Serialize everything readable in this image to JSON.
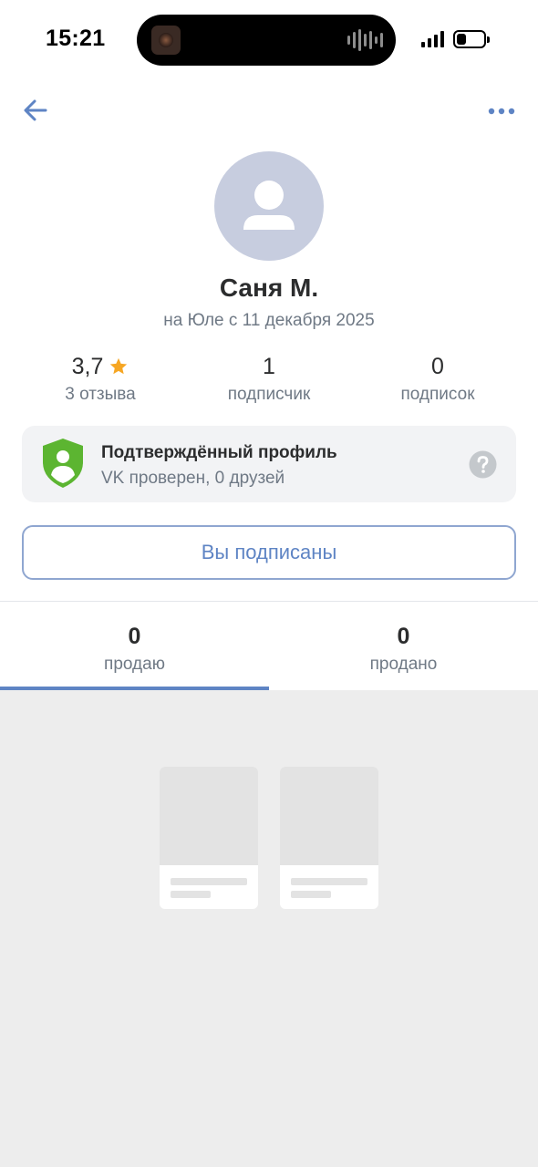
{
  "status_bar": {
    "time": "15:21",
    "battery_level": 0.35
  },
  "nav": {
    "back_icon": "arrow-left-icon",
    "more_icon": "more-horizontal-icon",
    "accent_color": "#5e84c4"
  },
  "profile": {
    "name": "Саня М.",
    "member_since": "на Юле с 11 декабря 2025",
    "avatar_icon": "user-placeholder-icon"
  },
  "stats": {
    "rating": {
      "value": "3,7",
      "label": "3 отзыва",
      "star_color": "#f6a623"
    },
    "followers": {
      "value": "1",
      "label": "подписчик"
    },
    "following": {
      "value": "0",
      "label": "подписок"
    }
  },
  "verification": {
    "title": "Подтверждённый профиль",
    "subtitle": "VK проверен, 0 друзей",
    "shield_color": "#5cb531",
    "icon": "verified-shield-icon",
    "help_icon": "question-circle-icon"
  },
  "subscribe_button": {
    "label": "Вы подписаны"
  },
  "tabs": [
    {
      "count": "0",
      "label": "продаю",
      "active": true
    },
    {
      "count": "0",
      "label": "продано",
      "active": false
    }
  ]
}
